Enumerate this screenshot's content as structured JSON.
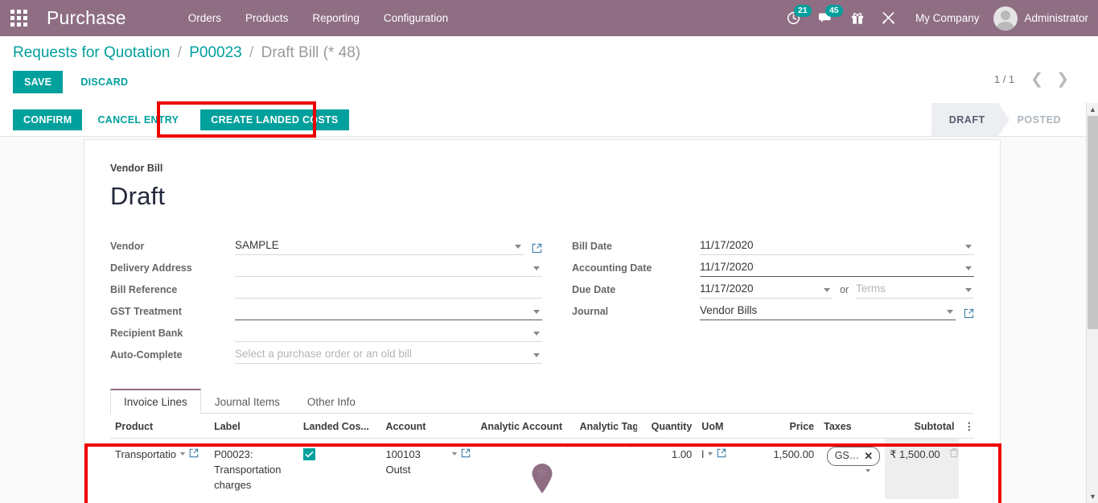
{
  "navbar": {
    "apps_icon": "apps-grid-icon",
    "brand": "Purchase",
    "menu": [
      {
        "label": "Orders"
      },
      {
        "label": "Products"
      },
      {
        "label": "Reporting"
      },
      {
        "label": "Configuration"
      }
    ],
    "activity_icon": "clock-activity-icon",
    "activity_count": "21",
    "messages_icon": "chat-messages-icon",
    "messages_count": "45",
    "gift_icon": "gift-icon",
    "tools_icon": "tools-icon",
    "company": "My Company",
    "user": "Administrator",
    "accent": "#00a09d",
    "navbar_color": "#8f6e84"
  },
  "control_panel": {
    "breadcrumb": [
      {
        "label": "Requests for Quotation",
        "active": false
      },
      {
        "label": "P00023",
        "active": false
      },
      {
        "label": "Draft Bill (* 48)",
        "active": true
      }
    ],
    "save_label": "SAVE",
    "discard_label": "DISCARD",
    "pager": "1 / 1",
    "prev_icon": "chevron-left-icon",
    "next_icon": "chevron-right-icon"
  },
  "statusbar": {
    "confirm_label": "CONFIRM",
    "cancel_label": "CANCEL ENTRY",
    "landed_costs_label": "CREATE LANDED COSTS",
    "stages": [
      {
        "label": "DRAFT",
        "state": "current"
      },
      {
        "label": "POSTED",
        "state": "upcoming"
      }
    ]
  },
  "form": {
    "sub_title": "Vendor Bill",
    "title": "Draft",
    "left_fields": [
      {
        "label": "Vendor",
        "value": "SAMPLE",
        "placeholder": "",
        "has_caret": true,
        "has_ext": true,
        "focused": false
      },
      {
        "label": "Delivery Address",
        "value": "",
        "placeholder": "",
        "has_caret": true,
        "has_ext": false,
        "focused": false
      },
      {
        "label": "Bill Reference",
        "value": "",
        "placeholder": "",
        "has_caret": false,
        "has_ext": false,
        "focused": false
      },
      {
        "label": "GST Treatment",
        "value": "",
        "placeholder": "",
        "has_caret": true,
        "has_ext": false,
        "focused": true
      },
      {
        "label": "Recipient Bank",
        "value": "",
        "placeholder": "",
        "has_caret": true,
        "has_ext": false,
        "focused": false
      },
      {
        "label": "Auto-Complete",
        "value": "",
        "placeholder": "Select a purchase order or an old bill",
        "has_caret": true,
        "has_ext": false,
        "focused": false
      }
    ],
    "right_fields": {
      "bill_date": {
        "label": "Bill Date",
        "value": "11/17/2020"
      },
      "accounting_date": {
        "label": "Accounting Date",
        "value": "11/17/2020"
      },
      "due_date": {
        "label": "Due Date",
        "value": "11/17/2020"
      },
      "or_word": "or",
      "terms": {
        "placeholder": "Terms"
      },
      "journal": {
        "label": "Journal",
        "value": "Vendor Bills"
      }
    }
  },
  "notebook": {
    "tabs": [
      {
        "label": "Invoice Lines",
        "active": true
      },
      {
        "label": "Journal Items",
        "active": false
      },
      {
        "label": "Other Info",
        "active": false
      }
    ]
  },
  "lines_table": {
    "headers": [
      "Product",
      "Label",
      "Landed Cos...",
      "Account",
      "Analytic Account",
      "Analytic Tags",
      "Quantity",
      "UoM",
      "Price",
      "Taxes",
      "Subtotal"
    ],
    "optional_columns_icon": "vertical-dots-icon",
    "rows": [
      {
        "product": "Transportatio",
        "label": "P00023: Transportation charges",
        "landed_cost": true,
        "account": "100103 Outst",
        "analytic_account": "",
        "analytic_tags": "",
        "quantity": "1.00",
        "uom": "l",
        "price": "1,500.00",
        "taxes": [
          {
            "name": "GS…"
          }
        ],
        "subtotal": "₹ 1,500.00",
        "delete_icon": "trash-icon"
      }
    ]
  },
  "annotations": {
    "highlight_color": "#ee0000",
    "boxes": [
      {
        "name": "create-landed-costs-highlight"
      },
      {
        "name": "invoice-line-row-highlight"
      }
    ],
    "cursor_marker": "map-pin-cursor-icon"
  },
  "scrollbar": {
    "up_icon": "scroll-up-icon",
    "down_icon": "scroll-down-icon"
  }
}
